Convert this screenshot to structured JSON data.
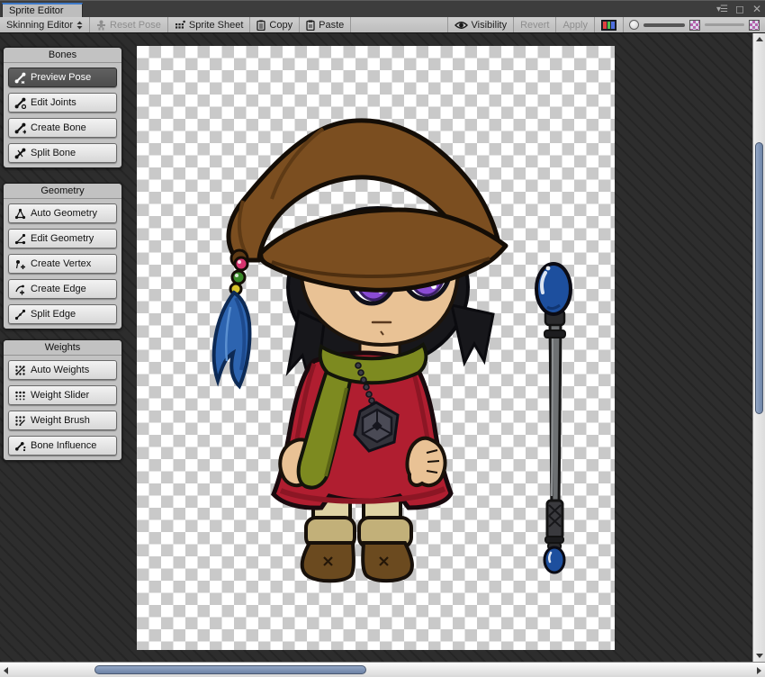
{
  "window": {
    "title": "Sprite Editor"
  },
  "toolbar": {
    "mode": "Skinning Editor",
    "reset_pose": "Reset Pose",
    "sprite_sheet": "Sprite Sheet",
    "copy": "Copy",
    "paste": "Paste",
    "visibility": "Visibility",
    "revert": "Revert",
    "apply": "Apply"
  },
  "panels": [
    {
      "title": "Bones",
      "buttons": [
        {
          "label": "Preview Pose",
          "active": true
        },
        {
          "label": "Edit Joints",
          "active": false
        },
        {
          "label": "Create Bone",
          "active": false
        },
        {
          "label": "Split Bone",
          "active": false
        }
      ]
    },
    {
      "title": "Geometry",
      "buttons": [
        {
          "label": "Auto Geometry",
          "active": false
        },
        {
          "label": "Edit Geometry",
          "active": false
        },
        {
          "label": "Create Vertex",
          "active": false
        },
        {
          "label": "Create Edge",
          "active": false
        },
        {
          "label": "Split Edge",
          "active": false
        }
      ]
    },
    {
      "title": "Weights",
      "buttons": [
        {
          "label": "Auto Weights",
          "active": false
        },
        {
          "label": "Weight Slider",
          "active": false
        },
        {
          "label": "Weight Brush",
          "active": false
        },
        {
          "label": "Bone Influence",
          "active": false
        }
      ]
    }
  ],
  "colors": {
    "tab_accent": "#3e79c8",
    "toolbar_bg": "#c5c5c5",
    "work_area_bg": "#2d2d2d",
    "scroll_thumb": "#7e93b6",
    "sprite_dress_red": "#b01e30",
    "sprite_scarf_olive": "#7d8a20",
    "sprite_hat_brown": "#7b4e20",
    "sprite_eye_purple": "#8a4bd4",
    "staff_gem_blue": "#1d4f9e"
  }
}
